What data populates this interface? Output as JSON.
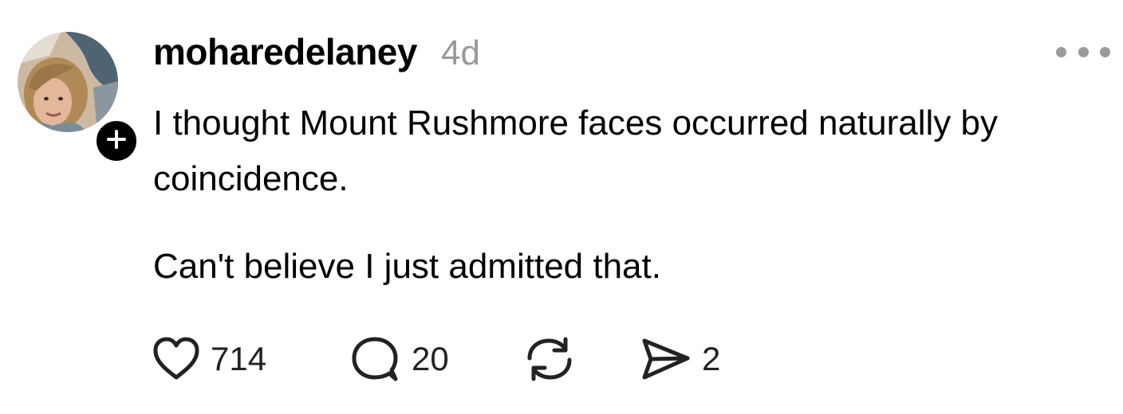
{
  "post": {
    "username": "moharedelaney",
    "timestamp": "4d",
    "paragraphs": [
      "I thought Mount Rushmore faces occurred naturally by coincidence.",
      "Can't believe I just admitted that."
    ],
    "actions": {
      "like_icon": "heart-icon",
      "like_count": "714",
      "reply_icon": "speech-bubble-icon",
      "reply_count": "20",
      "repost_icon": "repost-arrows-icon",
      "share_icon": "paper-plane-icon",
      "share_count": "2"
    },
    "more_icon": "ellipsis-icon",
    "follow_icon": "plus-icon"
  },
  "colors": {
    "text": "#000000",
    "muted": "#999999",
    "icon": "#222222",
    "badge": "#000000",
    "background": "#ffffff"
  }
}
